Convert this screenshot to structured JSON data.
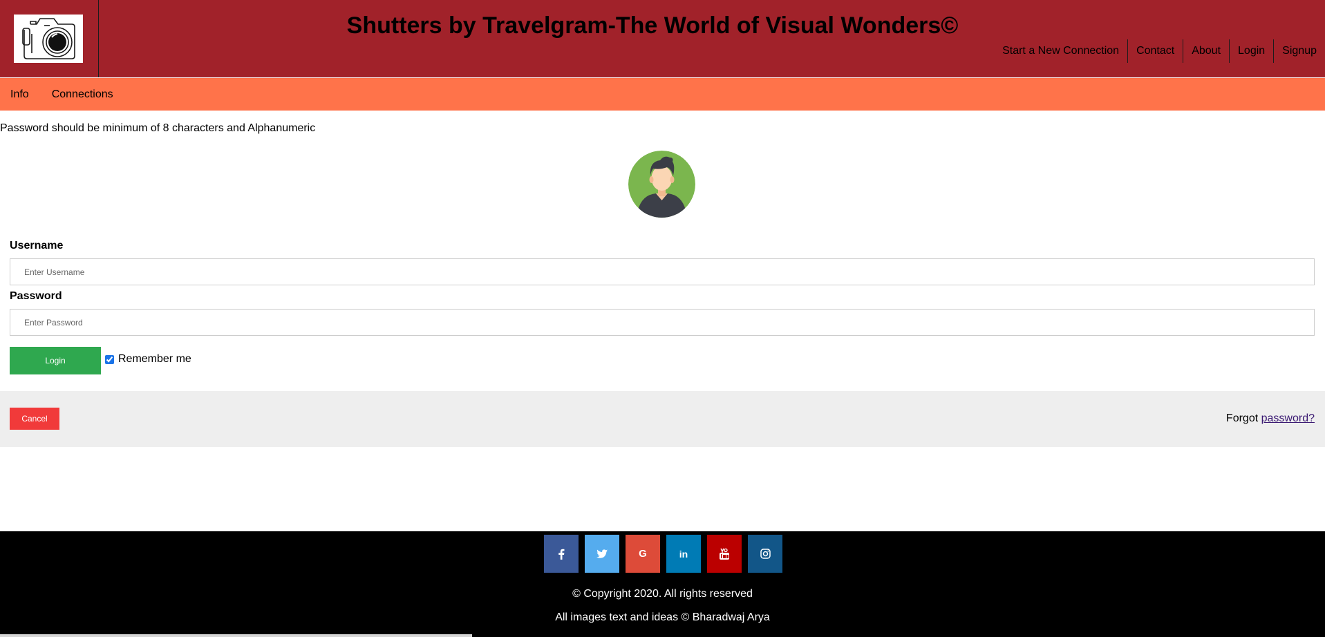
{
  "header": {
    "title": "Shutters by Travelgram-The World of Visual Wonders©",
    "nav": [
      "Start a New Connection",
      "Contact",
      "About",
      "Login",
      "Signup"
    ]
  },
  "subnav": [
    "Info",
    "Connections"
  ],
  "form": {
    "hint": "Password should be minimum of 8 characters and Alphanumeric",
    "username_label": "Username",
    "username_placeholder": "Enter Username",
    "password_label": "Password",
    "password_placeholder": "Enter Password",
    "login_label": "Login",
    "remember_label": "Remember me",
    "remember_checked": true,
    "cancel_label": "Cancel",
    "forgot_prefix": "Forgot",
    "forgot_link": "password?"
  },
  "footer": {
    "social": [
      {
        "icon": "facebook-icon",
        "glyph": "f",
        "color": "#3b5998"
      },
      {
        "icon": "twitter-icon",
        "glyph": "",
        "color": "#55acee"
      },
      {
        "icon": "google-icon",
        "glyph": "G",
        "color": "#dd4b39"
      },
      {
        "icon": "linkedin-icon",
        "glyph": "in",
        "color": "#007bb5"
      },
      {
        "icon": "youtube-icon",
        "glyph": "",
        "color": "#bb0000"
      },
      {
        "icon": "instagram-icon",
        "glyph": "",
        "color": "#125688"
      }
    ],
    "copyright": "© Copyright 2020. All rights reserved",
    "credits": "All images text and ideas © Bharadwaj Arya"
  },
  "colors": {
    "header": "#a1222a",
    "subnav": "#ff734a",
    "login_button": "#2fa84f",
    "cancel_button": "#f13a3a"
  }
}
